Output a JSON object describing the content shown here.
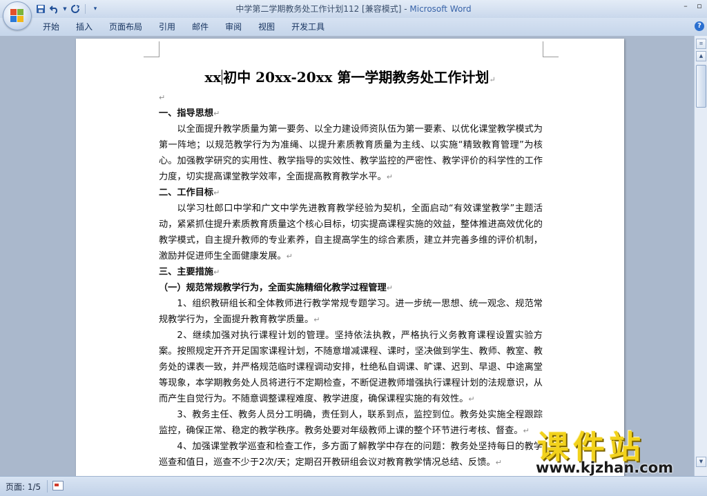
{
  "window": {
    "title": "中学第二学期教务处工作计划112 [兼容模式] - ",
    "app_name": "Microsoft Word"
  },
  "ribbon": {
    "tabs": [
      "开始",
      "插入",
      "页面布局",
      "引用",
      "邮件",
      "审阅",
      "视图",
      "开发工具"
    ]
  },
  "document": {
    "title": "xx初中20xx-20xx第一学期教务处工作计划",
    "title_left": "xx",
    "title_right": "初中 20xx-20xx 第一学期教务处工作计划",
    "paragraph_mark": "↵",
    "paragraphs": [
      {
        "style": "empty",
        "text": ""
      },
      {
        "style": "heading",
        "text": "一、指导思想"
      },
      {
        "style": "indent",
        "text": "以全面提升教学质量为第一要务、以全力建设师资队伍为第一要素、以优化课堂教学模式为第一阵地；以规范教学行为为准绳、以提升素质教育质量为主线、以实施“精致教育管理”为核心。加强教学研究的实用性、教学指导的实效性、教学监控的严密性、教学评价的科学性的工作力度，切实提高课堂教学效率，全面提高教育教学水平。"
      },
      {
        "style": "heading",
        "text": "二、工作目标"
      },
      {
        "style": "indent",
        "text": "以学习杜郎口中学和广文中学先进教育教学经验为契机，全面启动“有效课堂教学”主题活动，紧紧抓住提升素质教育质量这个核心目标，切实提高课程实施的效益，整体推进高效优化的教学模式，自主提升教师的专业素养，自主提高学生的综合素质，建立并完善多维的评价机制，激励并促进师生全面健康发展。"
      },
      {
        "style": "heading",
        "text": "三、主要措施"
      },
      {
        "style": "sub-heading",
        "text": "（一）规范常规教学行为，全面实施精细化教学过程管理"
      },
      {
        "style": "indent",
        "text": "1、组织教研组长和全体教师进行教学常规专题学习。进一步统一思想、统一观念、规范常规教学行为，全面提升教育教学质量。"
      },
      {
        "style": "indent",
        "text": "2、继续加强对执行课程计划的管理。坚持依法执教，严格执行义务教育课程设置实验方案。按照规定开齐开足国家课程计划，不随意增减课程、课时，坚决做到学生、教师、教室、教务处的课表一致，并严格规范临时课程调动安排，杜绝私自调课、旷课、迟到、早退、中途离堂等现象，本学期教务处人员将进行不定期检查，不断促进教师增强执行课程计划的法规意识，从而产生自觉行为。不随意调整课程难度、教学进度，确保课程实施的有效性。"
      },
      {
        "style": "indent",
        "text": "3、教务主任、教务人员分工明确，责任到人，联系到点，监控到位。教务处实施全程跟踪监控，确保正常、稳定的教学秩序。教务处要对年级教师上课的整个环节进行考核、督查。"
      },
      {
        "style": "indent",
        "text": "4、加强课堂教学巡查和检查工作，多方面了解教学中存在的问题：教务处坚持每日的教学巡查和值日，巡查不少于2次/天；定期召开教研组会议对教育教学情况总结、反馈。"
      }
    ]
  },
  "statusbar": {
    "page": "页面: 1/5"
  },
  "watermark": {
    "text": "课件站",
    "url": "www.kjzhan.com"
  },
  "colors": {
    "app_name": "#3863a8",
    "ribbon_bg": "#c5d5ea",
    "workspace_bg": "#aab8cc",
    "watermark_yellow": "#f2d21c"
  },
  "icons": [
    "office-button-icon",
    "save-icon",
    "undo-icon",
    "redo-icon",
    "customize-qat-icon",
    "minimize-icon",
    "restore-icon",
    "help-icon",
    "scroll-up-icon",
    "scroll-down-icon",
    "language-icon"
  ]
}
